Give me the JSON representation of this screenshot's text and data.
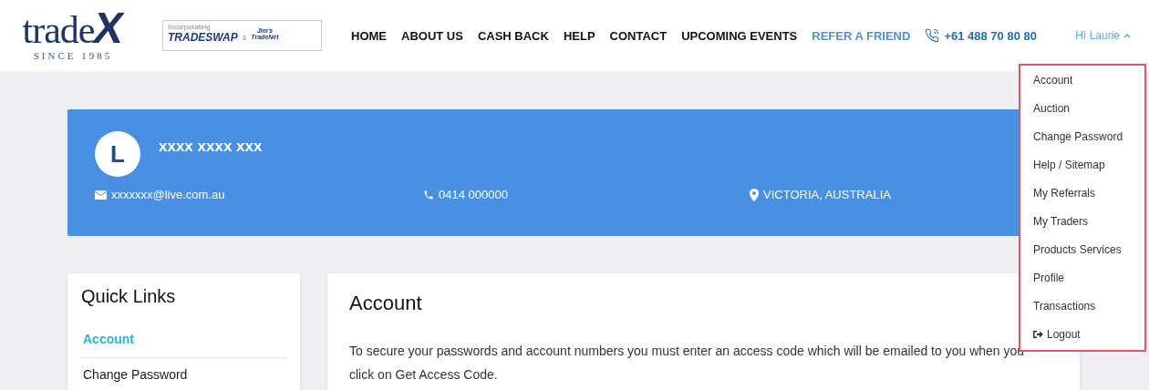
{
  "logo": {
    "wordmark": "trade",
    "mark": "X",
    "tagline": "SINCE 1985"
  },
  "partner_logo": {
    "caption": "Incorporating",
    "brand_1": "TRADESWAP",
    "separator": "&",
    "brand_2_top": "Jim's",
    "brand_2_bottom": "TradeNet"
  },
  "nav": [
    {
      "label": "HOME",
      "kind": "plain"
    },
    {
      "label": "ABOUT US",
      "kind": "plain"
    },
    {
      "label": "CASH BACK",
      "kind": "plain"
    },
    {
      "label": "HELP",
      "kind": "plain"
    },
    {
      "label": "CONTACT",
      "kind": "plain"
    },
    {
      "label": "UPCOMING EVENTS",
      "kind": "plain"
    },
    {
      "label": "REFER A FRIEND",
      "kind": "accent"
    }
  ],
  "phone": "+61 488 70 80 80",
  "user_menu": {
    "greeting": "Hi",
    "name": "Laurie",
    "expanded": true
  },
  "dropdown": [
    {
      "label": "Account",
      "kind": "item"
    },
    {
      "label": "Auction",
      "kind": "item"
    },
    {
      "label": "Change Password",
      "kind": "item"
    },
    {
      "label": "Help / Sitemap",
      "kind": "item"
    },
    {
      "label": "My Referrals",
      "kind": "item"
    },
    {
      "label": "My Traders",
      "kind": "item"
    },
    {
      "label": "Products Services",
      "kind": "item"
    },
    {
      "label": "Profile",
      "kind": "item"
    },
    {
      "label": "Transactions",
      "kind": "item"
    },
    {
      "label": "Logout",
      "kind": "logout"
    }
  ],
  "profile": {
    "initial": "L",
    "name": "xxxx xxxx xxx",
    "email": "xxxxxxx@live.com.au",
    "phone": "0414 000000",
    "location": "VICTORIA, AUSTRALIA"
  },
  "quick_links": {
    "title": "Quick Links",
    "items": [
      {
        "label": "Account",
        "selected": true
      },
      {
        "label": "Change Password",
        "selected": false
      }
    ]
  },
  "content": {
    "title": "Account",
    "text": "To secure your passwords and account numbers you must enter an access code which will be emailed to you when you click on Get Access Code."
  }
}
